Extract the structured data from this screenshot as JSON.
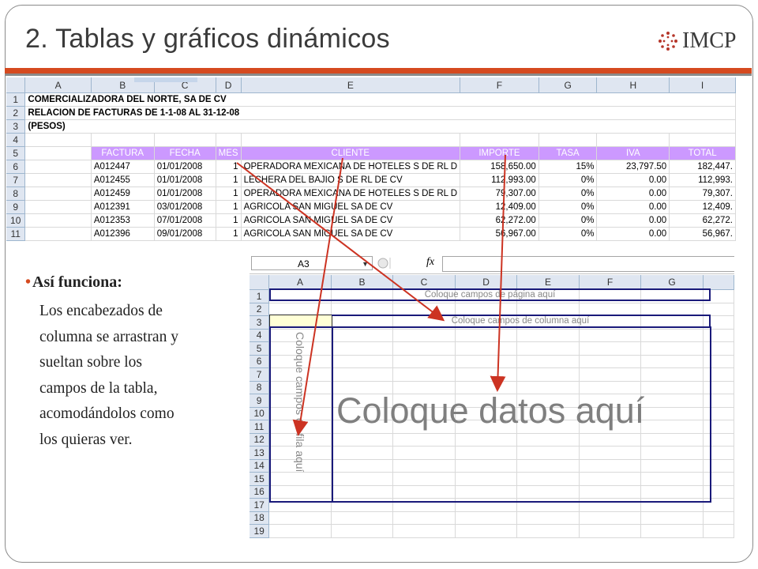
{
  "slide": {
    "title": "2. Tablas y gráficos dinámicos",
    "logo_text": "IMCP",
    "colors": {
      "accent_bar": "#d54a1f",
      "header_fill": "#cc99ff",
      "pivot_border": "#1a1a7a",
      "arrow": "#cc3322"
    }
  },
  "sheet1": {
    "columns": [
      "A",
      "B",
      "C",
      "D",
      "E",
      "F",
      "G",
      "H",
      "I"
    ],
    "row_numbers": [
      "1",
      "2",
      "3",
      "4",
      "5",
      "6",
      "7",
      "8",
      "9",
      "10",
      "11"
    ],
    "title_rows": [
      "COMERCIALIZADORA DEL NORTE, SA DE CV",
      "RELACION DE FACTURAS DE 1-1-08 AL 31-12-08",
      "(PESOS)"
    ],
    "headers": [
      "FACTURA",
      "FECHA",
      "MES",
      "CLIENTE",
      "IMPORTE",
      "TASA",
      "IVA",
      "TOTAL"
    ],
    "rows": [
      [
        "A012447",
        "01/01/2008",
        "1",
        "OPERADORA MEXICANA DE HOTELES S DE RL D",
        "158,650.00",
        "15%",
        "23,797.50",
        "182,447."
      ],
      [
        "A012455",
        "01/01/2008",
        "1",
        "LECHERA DEL BAJIO S DE RL DE CV",
        "112,993.00",
        "0%",
        "0.00",
        "112,993."
      ],
      [
        "A012459",
        "01/01/2008",
        "1",
        "OPERADORA MEXICANA DE HOTELES S DE RL D",
        "79,307.00",
        "0%",
        "0.00",
        "79,307."
      ],
      [
        "A012391",
        "03/01/2008",
        "1",
        "AGRICOLA SAN MIGUEL SA DE CV",
        "12,409.00",
        "0%",
        "0.00",
        "12,409."
      ],
      [
        "A012353",
        "07/01/2008",
        "1",
        "AGRICOLA SAN MIGUEL SA DE CV",
        "62,272.00",
        "0%",
        "0.00",
        "62,272."
      ],
      [
        "A012396",
        "09/01/2008",
        "1",
        "AGRICOLA SAN MIGUEL SA DE CV",
        "56,967.00",
        "0%",
        "0.00",
        "56,967."
      ]
    ]
  },
  "sheet2": {
    "name_box": "A3",
    "fx_label": "fx",
    "columns": [
      "A",
      "B",
      "C",
      "D",
      "E",
      "F",
      "G"
    ],
    "row_numbers": [
      "1",
      "2",
      "3",
      "4",
      "5",
      "6",
      "7",
      "8",
      "9",
      "10",
      "11",
      "12",
      "13",
      "14",
      "15",
      "16",
      "17",
      "18",
      "19"
    ],
    "page_drop": "Coloque campos de página aquí",
    "column_drop": "Coloque campos de columna aquí",
    "row_drop": "Coloque campos de fila aquí",
    "data_drop": "Coloque datos aquí"
  },
  "content": {
    "bullet_head": "Así funciona:",
    "body_lines": [
      "Los encabezados de",
      "columna se arrastran y",
      "sueltan sobre los",
      "campos de la tabla,",
      "acomodándolos como",
      "los quieras ver."
    ]
  }
}
